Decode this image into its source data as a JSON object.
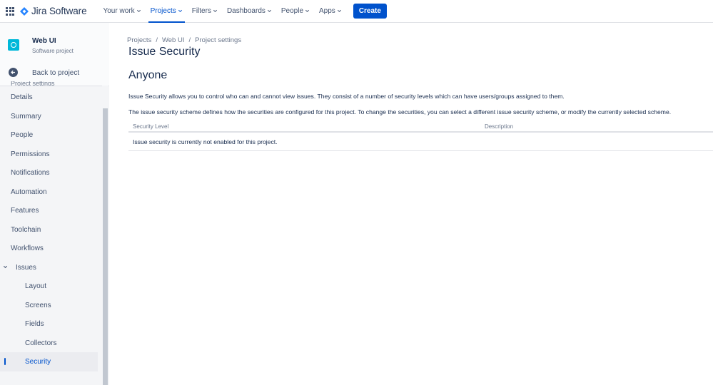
{
  "topnav": {
    "product": "Jira Software",
    "items": [
      {
        "label": "Your work"
      },
      {
        "label": "Projects"
      },
      {
        "label": "Filters"
      },
      {
        "label": "Dashboards"
      },
      {
        "label": "People"
      },
      {
        "label": "Apps"
      }
    ],
    "active_item": "Projects",
    "create_label": "Create",
    "brand_color": "#0052cc"
  },
  "sidebar": {
    "project_name": "Web UI",
    "project_type": "Software project",
    "back_label": "Back to project",
    "clipped_heading": "Project settings",
    "items": [
      {
        "label": "Details"
      },
      {
        "label": "Summary"
      },
      {
        "label": "People"
      },
      {
        "label": "Permissions"
      },
      {
        "label": "Notifications"
      },
      {
        "label": "Automation"
      },
      {
        "label": "Features"
      },
      {
        "label": "Toolchain"
      },
      {
        "label": "Workflows"
      },
      {
        "label": "Issues"
      }
    ],
    "issues_subitems": [
      {
        "label": "Layout"
      },
      {
        "label": "Screens"
      },
      {
        "label": "Fields"
      },
      {
        "label": "Collectors"
      },
      {
        "label": "Security"
      }
    ],
    "selected_item": "Security"
  },
  "breadcrumb": [
    "Projects",
    "Web UI",
    "Project settings"
  ],
  "main": {
    "title": "Issue Security",
    "scheme_name": "Anyone",
    "description_1": "Issue Security allows you to control who can and cannot view issues. They consist of a number of security levels which can have users/groups assigned to them.",
    "description_2": "The issue security scheme defines how the securities are configured for this project. To change the securities, you can select a different issue security scheme, or modify the currently selected scheme.",
    "table": {
      "headers": [
        "Security Level",
        "Description"
      ],
      "empty_message": "Issue security is currently not enabled for this project."
    }
  }
}
